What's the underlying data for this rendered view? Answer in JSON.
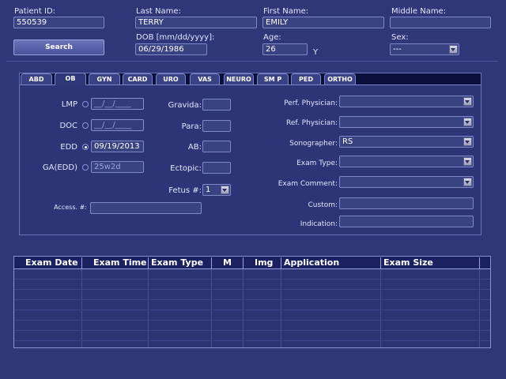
{
  "patient": {
    "id_label": "Patient ID:",
    "id_value": "550539",
    "last_label": "Last Name:",
    "last_value": "TERRY",
    "first_label": "First Name:",
    "first_value": "EMILY",
    "middle_label": "Middle Name:",
    "middle_value": "",
    "dob_label": "DOB [mm/dd/yyyy]:",
    "dob_value": "06/29/1986",
    "age_label": "Age:",
    "age_value": "26",
    "age_unit": "Y",
    "sex_label": "Sex:",
    "sex_value": "---",
    "search_label": "Search"
  },
  "tabs": [
    {
      "label": "ABD"
    },
    {
      "label": "OB"
    },
    {
      "label": "GYN"
    },
    {
      "label": "CARD"
    },
    {
      "label": "URO"
    },
    {
      "label": "VAS"
    },
    {
      "label": "NEURO"
    },
    {
      "label": "SM P"
    },
    {
      "label": "PED"
    },
    {
      "label": "ORTHO"
    }
  ],
  "active_tab": "OB",
  "ob": {
    "lmp_label": "LMP",
    "lmp_value": "__/__/____",
    "doc_label": "DOC",
    "doc_value": "__/__/____",
    "edd_label": "EDD",
    "edd_value": "09/19/2013",
    "ga_label": "GA(EDD)",
    "ga_value": "25w2d",
    "selected_date_option": "EDD",
    "gravida_label": "Gravida:",
    "gravida_value": "",
    "para_label": "Para:",
    "para_value": "",
    "ab_label": "AB:",
    "ab_value": "",
    "ectopic_label": "Ectopic:",
    "ectopic_value": "",
    "fetus_label": "Fetus #:",
    "fetus_value": "1",
    "access_label": "Access. #:",
    "access_value": ""
  },
  "exam": {
    "perf_label": "Perf. Physician:",
    "perf_value": "",
    "ref_label": "Ref. Physician:",
    "ref_value": "",
    "sono_label": "Sonographer:",
    "sono_value": "RS",
    "type_label": "Exam Type:",
    "type_value": "",
    "comment_label": "Exam Comment:",
    "comment_value": "",
    "custom_label": "Custom:",
    "custom_value": "",
    "indication_label": "Indication:",
    "indication_value": ""
  },
  "table": {
    "columns": [
      "Exam Date",
      "Exam Time",
      "Exam Type",
      "M",
      "Img",
      "Application",
      "Exam Size"
    ],
    "rows": []
  },
  "colors": {
    "background": "#2f3778",
    "panel": "#2d3576",
    "field": "#3a4382",
    "tab_bar": "#0b0f3c"
  }
}
